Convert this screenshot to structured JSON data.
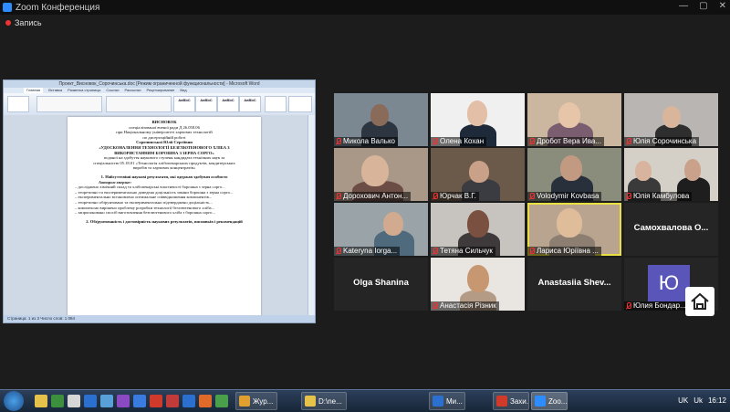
{
  "window": {
    "title": "Zoom Конференция"
  },
  "recording": {
    "label": "Запись"
  },
  "word": {
    "title": "Проект_Висновок_Сорочинська.doc [Режим ограниченной функциональности] - Microsoft Word",
    "tabs": [
      "Главная",
      "Вставка",
      "Разметка страницы",
      "Ссылки",
      "Рассылки",
      "Рецензирование",
      "Вид"
    ],
    "status": "Страница: 1 из 3   Число слов: 1 084",
    "doc_lines": [
      "ВИСНОВОК",
      "спеціалізованої вченої ради Д 26.058.06",
      "при Національному університеті харчових технологій",
      "по дисертаційній роботі",
      "Сорочинської Юлії Сергіївни",
      "«УДОСКОНАЛЕННЯ ТЕХНОЛОГІЇ БЕЗГЛЮТЕНОВОГО ХЛІБА З",
      "ВИКОРИСТАННЯМ БОРОШНА З ЗЕРНА СОРГО»",
      "поданої на здобуття наукового ступеня кандидата технічних наук за",
      "спеціальністю 05.18.01 «Технологія хлібопекарських продуктів, кондитерських",
      "виробів та харчових концентратів»",
      "1. Найсуттєвіші наукові результати, які одержав здобувач особисто",
      "Автором вперше:",
      "– досліджено хімічний склад та хлібопекарські властивості борошна з зерна сорго...",
      "– теоретично та експериментально доведена доцільність заміни борошна з зерна сорго...",
      "– експериментально встановлено оптимальне співвідношення компонентів...",
      "– теоретично обґрунтовано та експериментально підтверджено доцільність...",
      "– комплексно вирішено проблему розробки технології безглютенового хліба...",
      "– запропоновано спосіб виготовлення безглютенового хліба з борошна сорго...",
      "2. Обґрунтованість і достовірність наукових результатів, висновків і рекомендацій"
    ]
  },
  "participants": [
    {
      "name": "Микола Валько"
    },
    {
      "name": "Олена Кохан"
    },
    {
      "name": "Дробот Вера Ива..."
    },
    {
      "name": "Юлія Сорочинська"
    },
    {
      "name": "Дорохович Антон..."
    },
    {
      "name": "Юрчак В.Г."
    },
    {
      "name": "Volodymir Kovbasa"
    },
    {
      "name": "Юлія  Камбулова"
    },
    {
      "name": "Kateryna Iorga..."
    },
    {
      "name": "Тетяна Сильчук"
    },
    {
      "name": "Лариса Юріївна ..."
    },
    {
      "name": "Самохвалова  О..."
    },
    {
      "name": "Olga Shanina"
    },
    {
      "name": "Анастасія Різник"
    },
    {
      "name": "Anastasiia  Shev..."
    },
    {
      "name": "Юлия Бондар..."
    }
  ],
  "avatar_letter": "Ю",
  "taskbar": {
    "tasks": [
      "Жур...",
      "D:\\ne...",
      "Ми...",
      "Захи...",
      "Zoo..."
    ],
    "language": "UK",
    "tray_lang2": "Uk",
    "time": "16:12"
  }
}
